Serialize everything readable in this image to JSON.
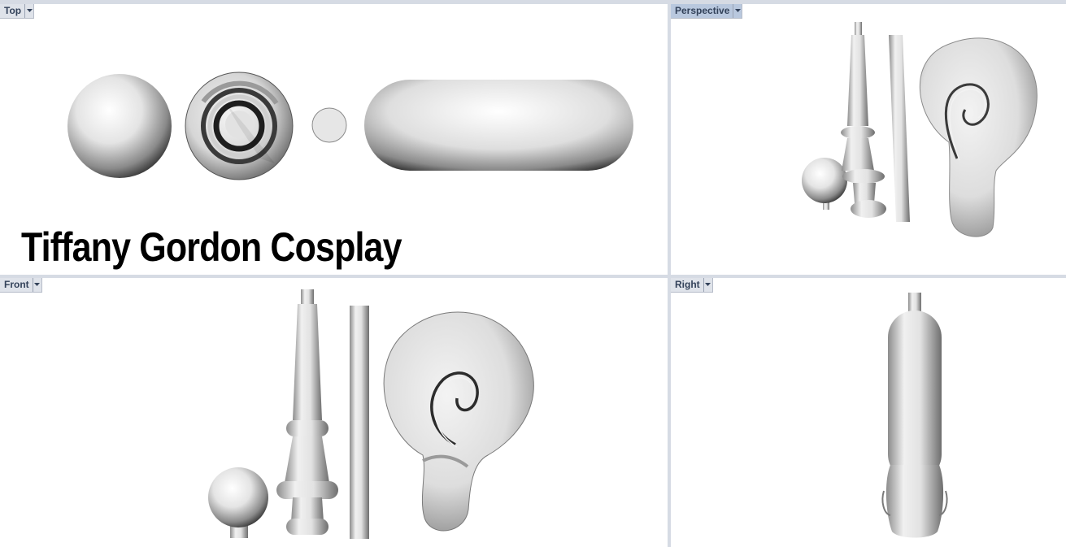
{
  "viewports": {
    "top": {
      "label": "Top",
      "active": false
    },
    "perspective": {
      "label": "Perspective",
      "active": true
    },
    "front": {
      "label": "Front",
      "active": false
    },
    "right": {
      "label": "Right",
      "active": false
    }
  },
  "watermark": "Tiffany Gordon Cosplay",
  "icons": {
    "viewport_menu": "chevron-down-icon"
  },
  "colors": {
    "active_tab": "#b9c8de",
    "inactive_tab": "#dfe3ea",
    "viewport_bg": "#ffffff",
    "frame": "#d6dbe4"
  }
}
